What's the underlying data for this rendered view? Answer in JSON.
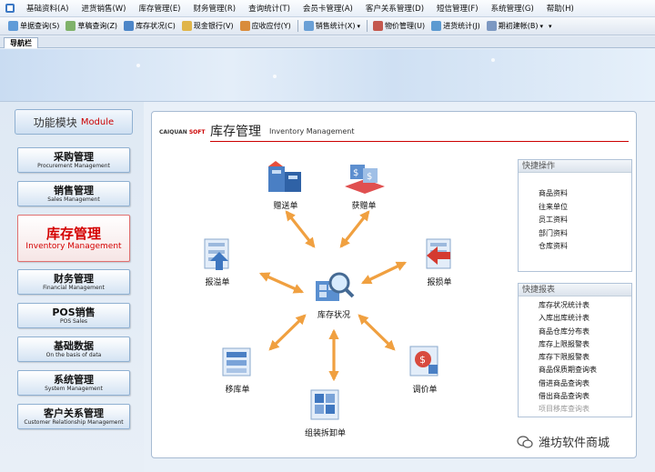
{
  "menu": [
    "基础资料(A)",
    "进货销售(W)",
    "库存管理(E)",
    "财务管理(R)",
    "查询统计(T)",
    "会员卡管理(A)",
    "客户关系管理(D)",
    "短信管理(F)",
    "系统管理(G)",
    "帮助(H)"
  ],
  "toolbar": [
    {
      "label": "单据查询(S)",
      "color": "#5f9bd8"
    },
    {
      "label": "草稿查询(Z)",
      "color": "#7fb26a"
    },
    {
      "label": "库存状况(C)",
      "color": "#4d86c8"
    },
    {
      "label": "现金银行(V)",
      "color": "#e0b54a"
    },
    {
      "label": "应收应付(Y)",
      "color": "#d98c3c"
    },
    {
      "label": "销售统计(X)",
      "color": "#6aa0d6",
      "dropdown": true
    },
    {
      "label": "物价管理(U)",
      "color": "#c4584e"
    },
    {
      "label": "进货统计(J)",
      "color": "#5c9ad1"
    },
    {
      "label": "期初建帐(B)",
      "color": "#7c98c2",
      "dropdown": true
    }
  ],
  "nav_tab": "导航栏",
  "left_panel": {
    "header_cn": "功能模块",
    "header_en": "Module",
    "modules": [
      {
        "cn": "采购管理",
        "en": "Procurement Management"
      },
      {
        "cn": "销售管理",
        "en": "Sales Management"
      },
      {
        "cn": "库存管理",
        "en": "Inventory Management",
        "active": true
      },
      {
        "cn": "财务管理",
        "en": "Financial Management"
      },
      {
        "cn": "POS销售",
        "en": "POS Sales"
      },
      {
        "cn": "基础数据",
        "en": "On the basis of data"
      },
      {
        "cn": "系统管理",
        "en": "System Management"
      },
      {
        "cn": "客户关系管理",
        "en": "Customer Relationship Management"
      }
    ]
  },
  "main": {
    "brand_a": "CAIQUAN",
    "brand_b": "SOFT",
    "title_cn": "库存管理",
    "title_en": "Inventory Management",
    "hub": "库存状况",
    "nodes": [
      "赠送单",
      "获赠单",
      "报溢单",
      "报损单",
      "移库单",
      "调价单",
      "组装拆卸单"
    ],
    "accent": "#f0a040"
  },
  "quick_ops": {
    "title": "快捷操作",
    "items": [
      "商品资料",
      "往来单位",
      "员工资料",
      "部门资料",
      "仓库资料"
    ]
  },
  "quick_reports": {
    "title": "快捷报表",
    "items": [
      "库存状况统计表",
      "入库出库统计表",
      "商品仓库分布表",
      "库存上限报警表",
      "库存下限报警表",
      "商品保质期查询表",
      "借进商品查询表",
      "借出商品查询表",
      "项目移库查询表"
    ]
  },
  "watermark": "潍坊软件商城"
}
